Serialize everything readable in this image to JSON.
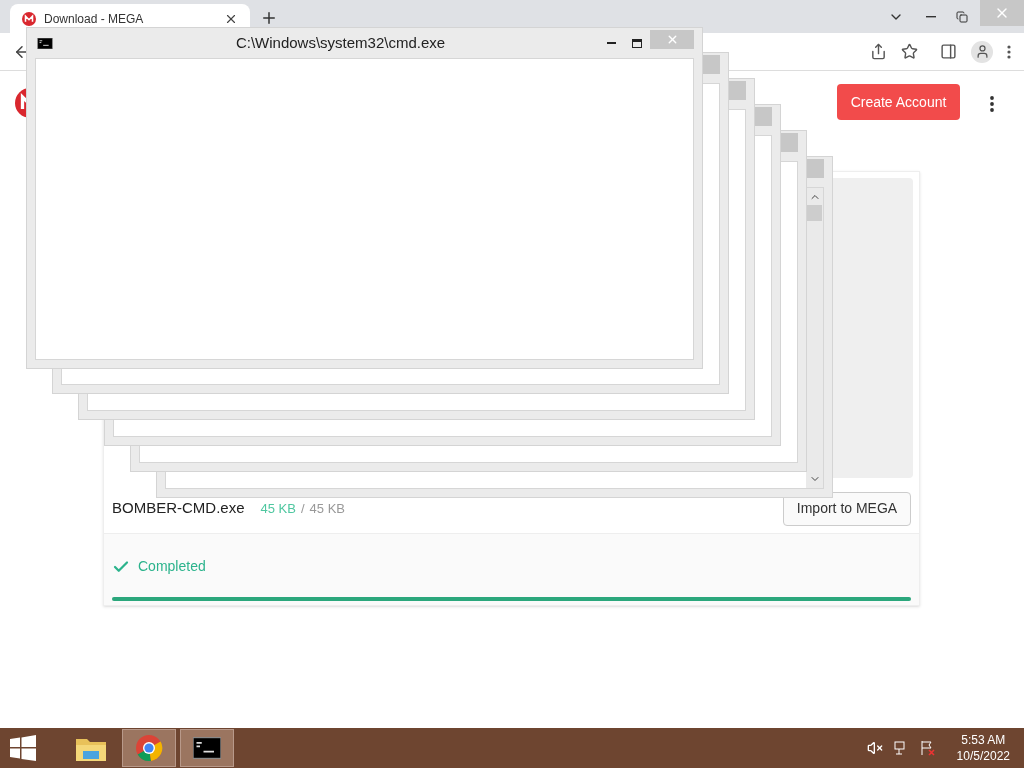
{
  "browser": {
    "tabs": [
      {
        "title": "Download - MEGA",
        "selected": true
      }
    ]
  },
  "page": {
    "create_account": "Create Account",
    "file": {
      "name": "BOMBER-CMD.exe",
      "downloaded": "45 KB",
      "separator": "/",
      "total": "45 KB"
    },
    "import_button": "Import to MEGA",
    "status": "Completed",
    "level": 1
  },
  "cmd_windows": [
    {
      "title": "C:\\Windows\\system32\\cmd.exe"
    }
  ],
  "taskbar": {
    "apps": [
      {
        "kind": "explorer",
        "selected": false
      },
      {
        "kind": "chrome",
        "selected": true
      },
      {
        "kind": "cmd",
        "selected": true
      }
    ],
    "time": "5:53 AM",
    "date": "10/5/2022"
  }
}
